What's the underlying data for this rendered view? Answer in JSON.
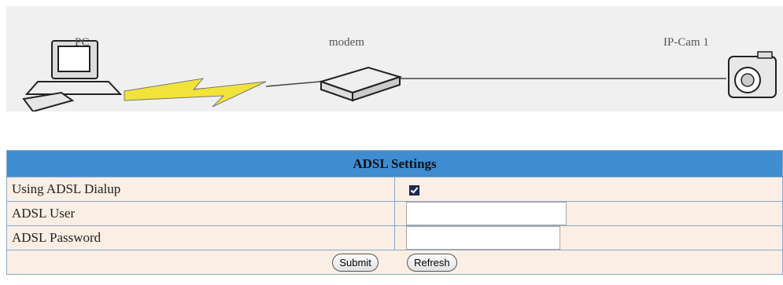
{
  "diagram": {
    "pc_label": "PC",
    "modem_label": "modem",
    "camera_label": "IP-Cam 1"
  },
  "form": {
    "title": "ADSL Settings",
    "dialup_label": "Using ADSL Dialup",
    "dialup_checked": true,
    "user_label": "ADSL User",
    "user_value": "",
    "password_label": "ADSL Password",
    "password_value": "",
    "submit_label": "Submit",
    "refresh_label": "Refresh"
  },
  "colors": {
    "header_bg": "#3f8cd0",
    "row_bg": "#fbeee4",
    "lightning": "#f2e33a"
  }
}
